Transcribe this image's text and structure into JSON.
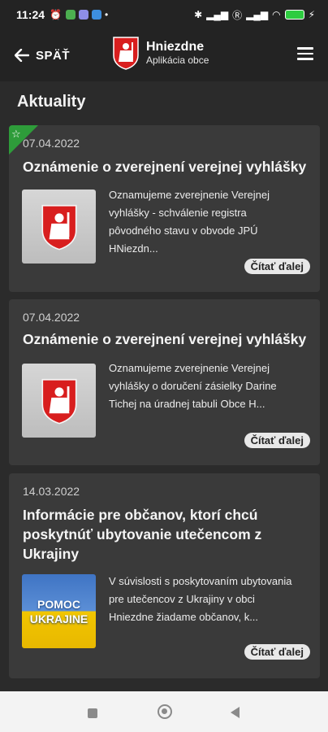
{
  "status_bar": {
    "time": "11:24",
    "battery": "100"
  },
  "app_bar": {
    "back_label": "SPÄŤ",
    "title": "Hniezdne",
    "subtitle": "Aplikácia obce"
  },
  "page": {
    "title": "Aktuality"
  },
  "articles": [
    {
      "date": "07.04.2022",
      "title": "Oznámenie o zverejnení verejnej vyhlášky",
      "excerpt": "Oznamujeme zverejnenie Verejnej vyhlášky - schválenie registra pôvodného stavu v obvode JPÚ HNiezdn...",
      "read_more": "Čítať ďalej",
      "featured": true
    },
    {
      "date": "07.04.2022",
      "title": "Oznámenie o zverejnení verejnej vyhlášky",
      "excerpt": "Oznamujeme zverejnenie Verejnej vyhlášky o doručení zásielky Darine Tichej na úradnej tabuli Obce H...",
      "read_more": "Čítať ďalej",
      "featured": false
    },
    {
      "date": "14.03.2022",
      "title": "Informácie pre občanov, ktorí chcú poskytnúť ubytovanie utečencom z Ukrajiny",
      "excerpt": "V súvislosti s poskytovaním ubytovania pre utečencov z Ukrajiny v obci Hniezdne žiadame občanov, k...",
      "read_more": "Čítať ďalej",
      "featured": false,
      "thumb_text_1": "POMOC",
      "thumb_text_2": "UKRAJINE"
    }
  ],
  "icons": {
    "back": "arrow-left-icon",
    "menu": "hamburger-menu-icon",
    "crest": "coat-of-arms-icon",
    "star": "star-outline-icon"
  },
  "colors": {
    "accent": "#2e9c3a",
    "crest_red": "#d81e1e"
  }
}
